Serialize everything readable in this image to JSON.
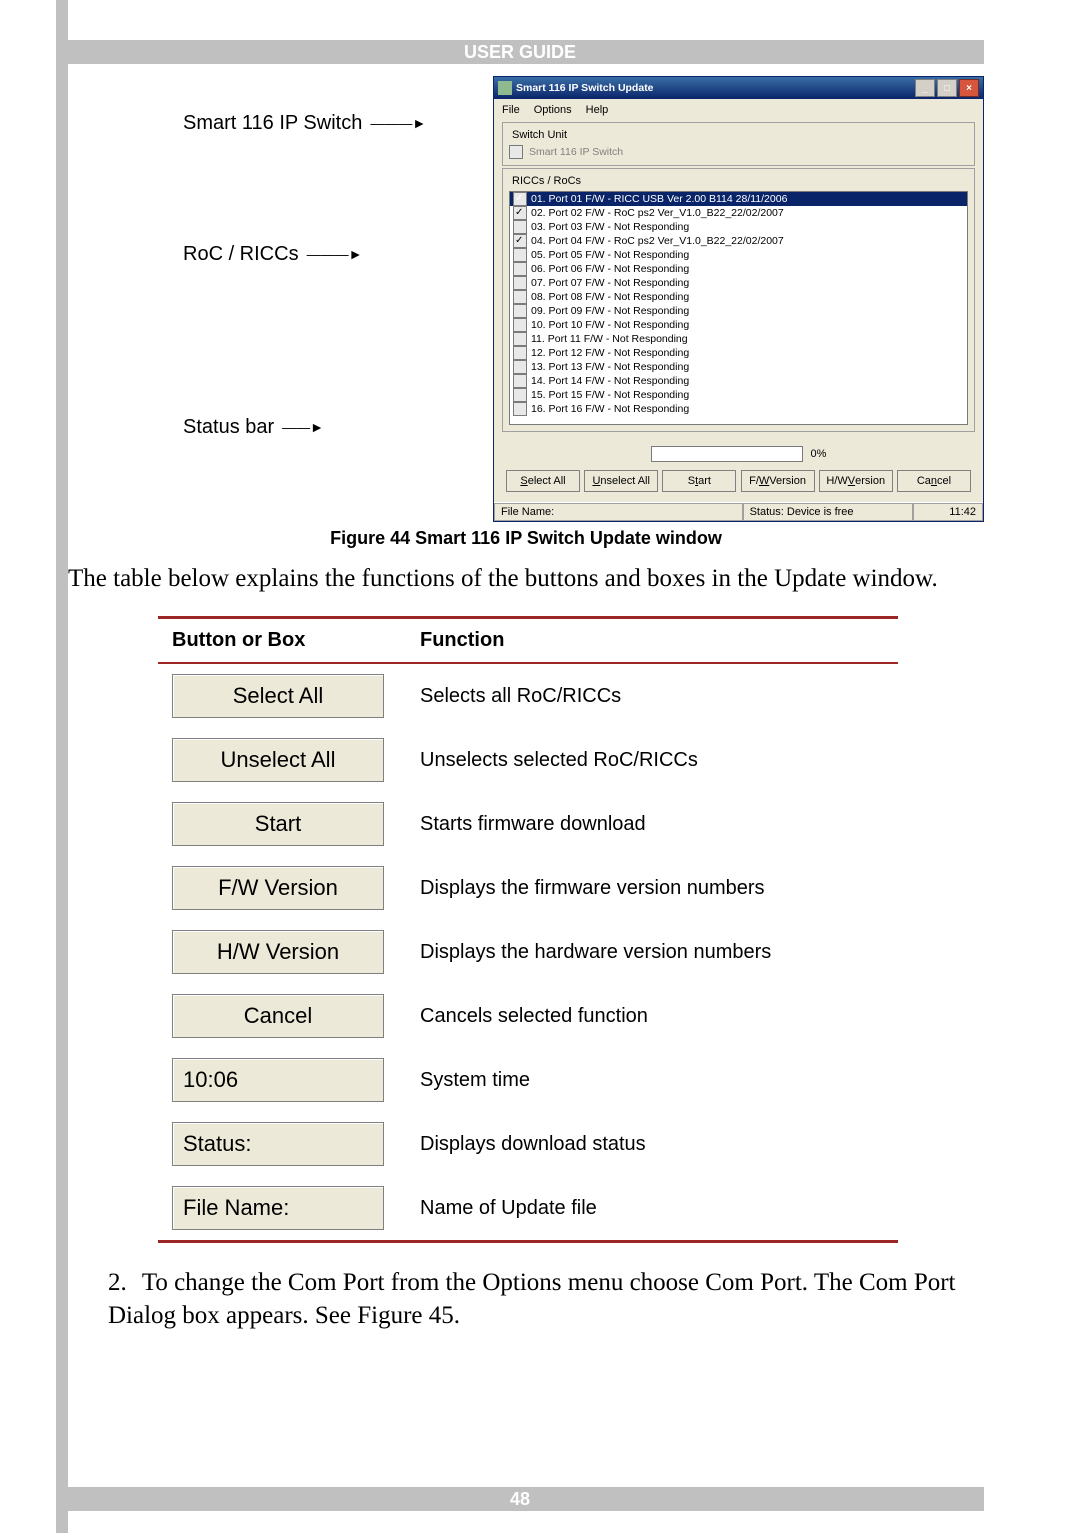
{
  "header_title": "USER GUIDE",
  "page_number": "48",
  "labels": {
    "smart_switch": "Smart 116 IP Switch",
    "roc_riccs": "RoC / RICCs",
    "status_bar": "Status bar"
  },
  "window": {
    "title": "Smart 116 IP Switch Update",
    "menu": {
      "file": "File",
      "options": "Options",
      "help": "Help"
    },
    "switch_unit": {
      "legend": "Switch Unit",
      "text": "Smart 116 IP Switch"
    },
    "list_legend": "RICCs / RoCs",
    "ports": [
      {
        "checked": true,
        "selected": true,
        "text": "01. Port 01  F/W - RICC USB Ver 2.00 B114 28/11/2006"
      },
      {
        "checked": true,
        "selected": false,
        "text": "02. Port 02  F/W - RoC ps2 Ver_V1.0_B22_22/02/2007"
      },
      {
        "checked": false,
        "selected": false,
        "text": "03. Port 03  F/W - Not Responding"
      },
      {
        "checked": true,
        "selected": false,
        "text": "04. Port 04  F/W - RoC ps2 Ver_V1.0_B22_22/02/2007"
      },
      {
        "checked": false,
        "selected": false,
        "text": "05. Port 05  F/W - Not Responding"
      },
      {
        "checked": false,
        "selected": false,
        "text": "06. Port 06  F/W - Not Responding"
      },
      {
        "checked": false,
        "selected": false,
        "text": "07. Port 07  F/W - Not Responding"
      },
      {
        "checked": false,
        "selected": false,
        "text": "08. Port 08  F/W - Not Responding"
      },
      {
        "checked": false,
        "selected": false,
        "text": "09. Port 09  F/W - Not Responding"
      },
      {
        "checked": false,
        "selected": false,
        "text": "10. Port 10  F/W - Not Responding"
      },
      {
        "checked": false,
        "selected": false,
        "text": "11. Port 11  F/W - Not Responding"
      },
      {
        "checked": false,
        "selected": false,
        "text": "12. Port 12  F/W - Not Responding"
      },
      {
        "checked": false,
        "selected": false,
        "text": "13. Port 13  F/W - Not Responding"
      },
      {
        "checked": false,
        "selected": false,
        "text": "14. Port 14  F/W - Not Responding"
      },
      {
        "checked": false,
        "selected": false,
        "text": "15. Port 15  F/W - Not Responding"
      },
      {
        "checked": false,
        "selected": false,
        "text": "16. Port 16  F/W - Not Responding"
      }
    ],
    "progress_text": "0%",
    "buttons": {
      "select_all": "Select All",
      "unselect_all": "Unselect All",
      "start": "Start",
      "fw_version": "F/W Version",
      "hw_version": "H/W Version",
      "cancel": "Cancel"
    },
    "status": {
      "file_name_label": "File Name:",
      "status_text": "Status: Device is free",
      "time": "11:42"
    }
  },
  "figure_caption": "Figure 44 Smart 116 IP Switch Update window",
  "explain_text": "The table below explains the functions of the buttons and boxes in the Update window.",
  "table": {
    "headers": {
      "button": "Button or Box",
      "function": "Function"
    },
    "rows": [
      {
        "button": "Select All",
        "function": "Selects all RoC/RICCs",
        "type": "btn"
      },
      {
        "button": "Unselect All",
        "function": "Unselects selected RoC/RICCs",
        "type": "btn"
      },
      {
        "button": "Start",
        "function": "Starts firmware download",
        "type": "btn"
      },
      {
        "button": "F/W Version",
        "function": "Displays the firmware version numbers",
        "type": "btn"
      },
      {
        "button": "H/W Version",
        "function": "Displays the hardware version numbers",
        "type": "btn"
      },
      {
        "button": "Cancel",
        "function": "Cancels selected function",
        "type": "btn"
      },
      {
        "button": "10:06",
        "function": "System time",
        "type": "field"
      },
      {
        "button": "Status:",
        "function": "Displays download status",
        "type": "field"
      },
      {
        "button": "File Name:",
        "function": "Name of Update file",
        "type": "field"
      }
    ]
  },
  "step2": {
    "number": "2.",
    "text": "To change the Com Port from the Options menu choose Com Port. The Com Port Dialog box appears. See Figure 45."
  }
}
